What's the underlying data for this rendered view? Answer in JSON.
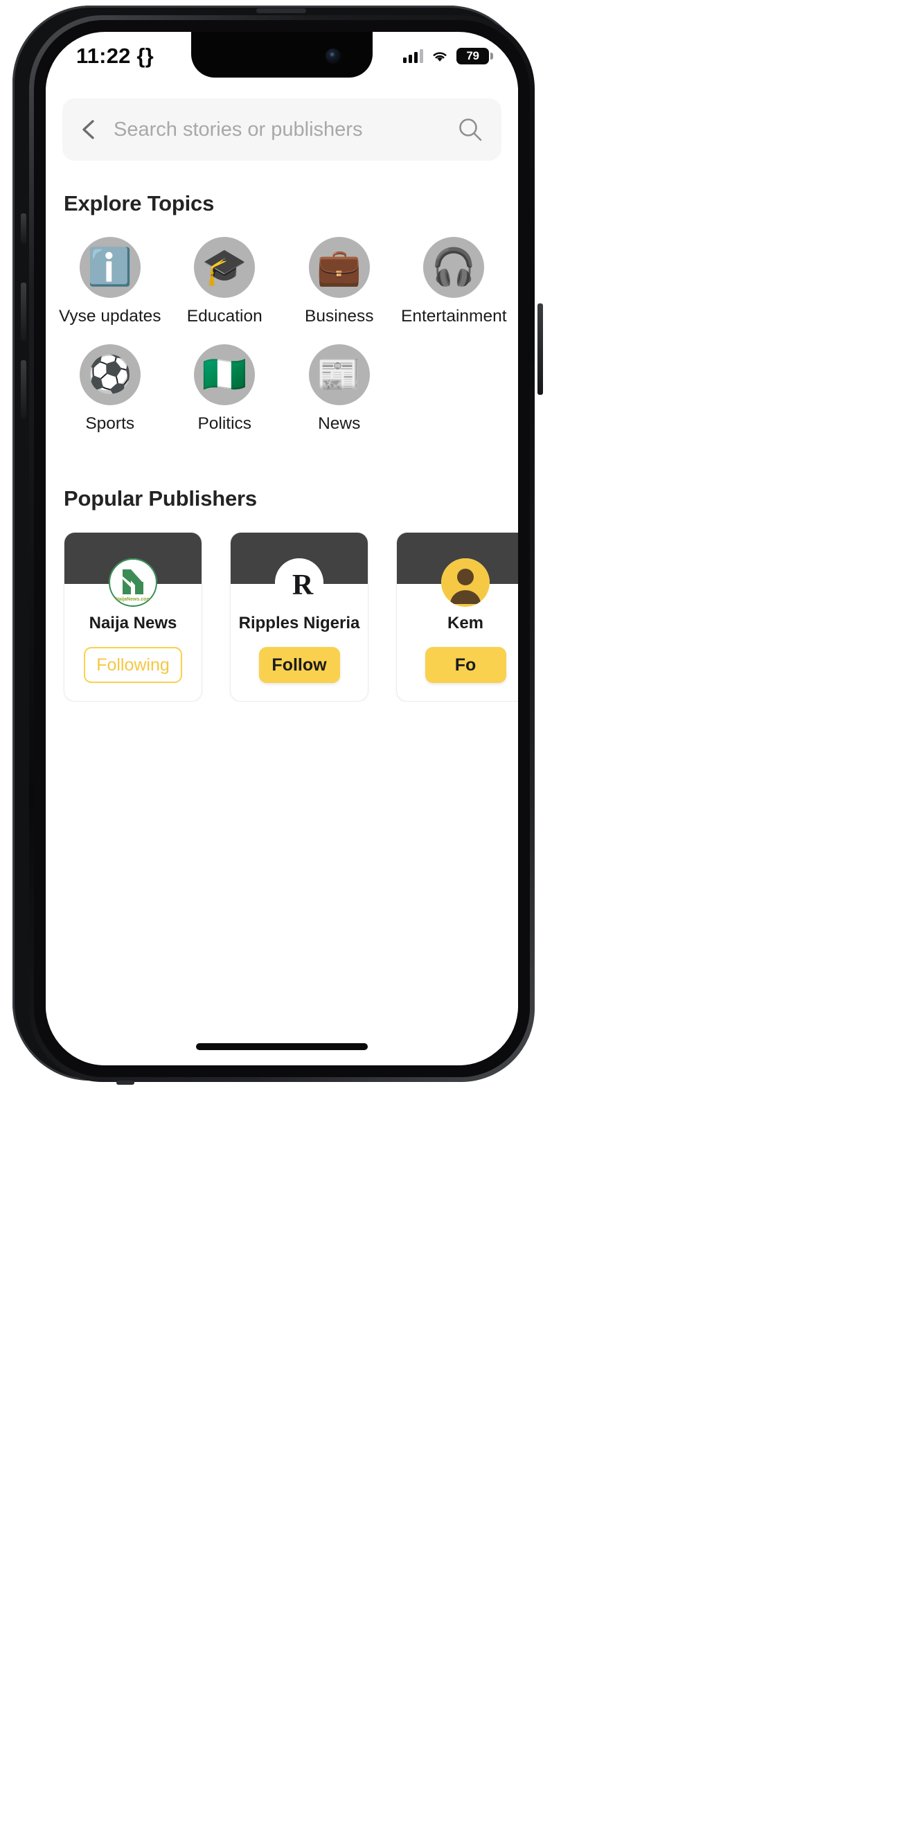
{
  "status_bar": {
    "time": "11:22 {}",
    "battery_level": "79",
    "signal_icon": "cellular-signal-icon",
    "wifi_icon": "wifi-icon",
    "battery_icon": "battery-icon"
  },
  "search": {
    "placeholder": "Search stories or publishers",
    "value": "",
    "back_icon": "back-chevron-icon",
    "search_icon": "search-icon"
  },
  "explore": {
    "title": "Explore Topics",
    "topics": [
      {
        "label": "Vyse updates",
        "emoji": "ℹ️",
        "icon_name": "information-icon"
      },
      {
        "label": "Education",
        "emoji": "🎓",
        "icon_name": "graduation-cap-icon"
      },
      {
        "label": "Business",
        "emoji": "💼",
        "icon_name": "briefcase-icon"
      },
      {
        "label": "Entertainment",
        "emoji": "🎧",
        "icon_name": "headphones-icon"
      },
      {
        "label": "Sports",
        "emoji": "⚽",
        "icon_name": "soccer-ball-icon"
      },
      {
        "label": "Politics",
        "emoji": "🇳🇬",
        "icon_name": "nigeria-flag-icon"
      },
      {
        "label": "News",
        "emoji": "📰",
        "icon_name": "newspaper-icon"
      }
    ]
  },
  "publishers": {
    "title": "Popular Publishers",
    "cards": [
      {
        "name": "Naija News",
        "button_label": "Following",
        "button_state": "following",
        "logo_name": "naija-news-logo"
      },
      {
        "name": "Ripples Nigeria",
        "button_label": "Follow",
        "button_state": "follow",
        "logo_name": "ripples-nigeria-logo"
      },
      {
        "name": "Kem",
        "button_label": "Fo",
        "button_state": "follow",
        "logo_name": "kemi-logo"
      }
    ]
  },
  "colors": {
    "accent_yellow": "#F9D14E",
    "accent_yellow_text": "#F5C843",
    "banner_dark": "#424242",
    "topic_circle_grey": "#b3b3b3",
    "search_bg": "#f6f6f6"
  },
  "home_indicator": "home-indicator-bar"
}
